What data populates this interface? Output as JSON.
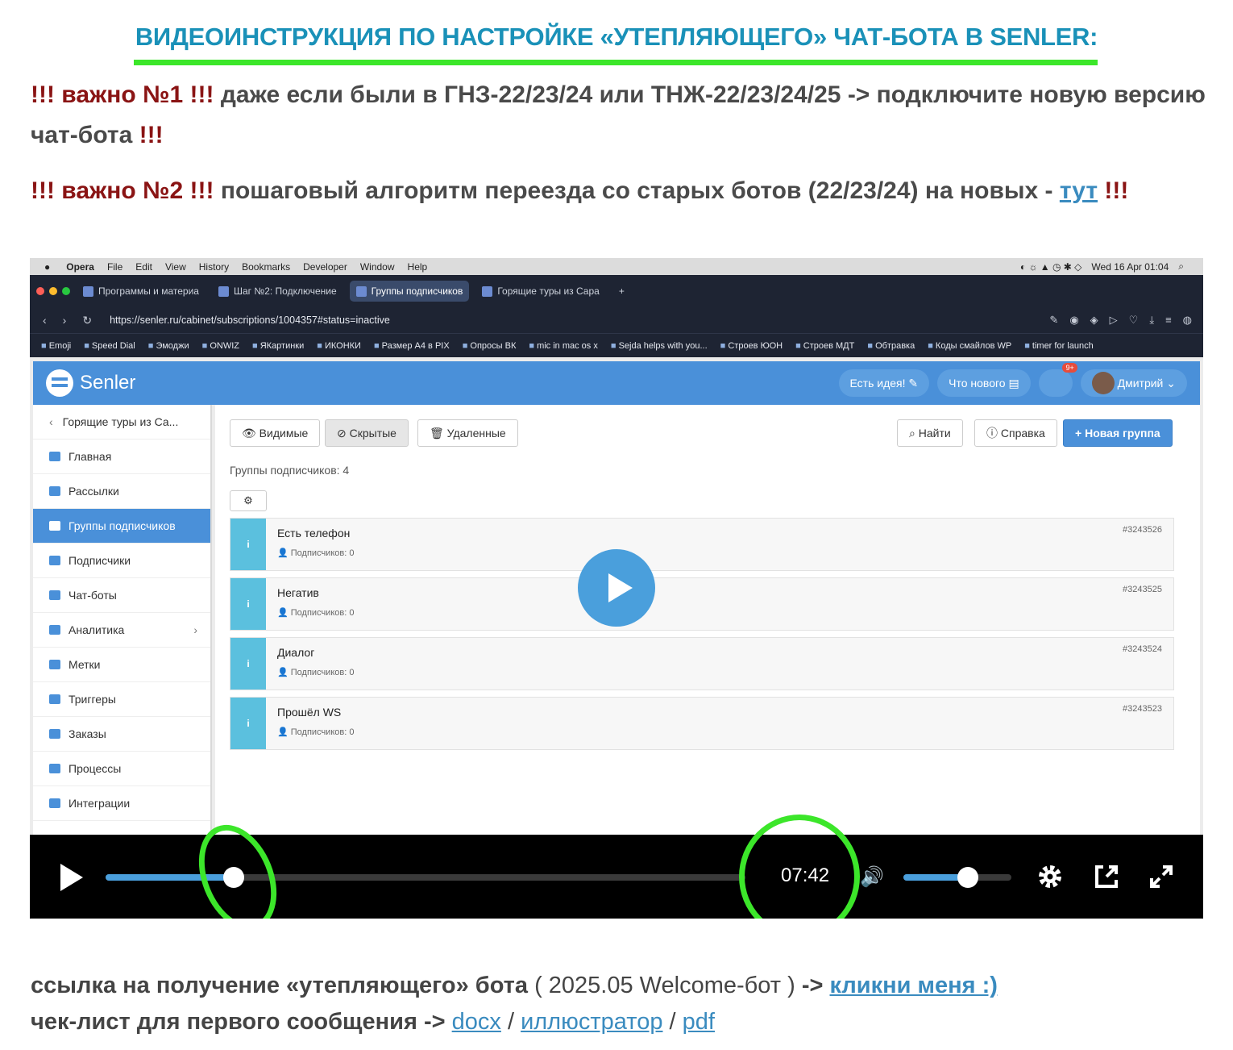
{
  "title": "ВИДЕОИНСТРУКЦИЯ ПО НАСТРОЙКЕ «УТЕПЛЯЮЩЕГО» ЧАТ-БОТА В SENLER:",
  "note1": {
    "prefix": "!!! важно №1 !!!",
    "text": " даже если были в ГНЗ-22/23/24 или ТНЖ-22/23/24/25 -> подключите новую версию чат-бота ",
    "suffix": "!!!"
  },
  "note2": {
    "prefix": "!!! важно №2 !!!",
    "text": " пошаговый алгоритм переезда со старых ботов (22/23/24) на новых - ",
    "link": "тут",
    "suffix": " !!!"
  },
  "video": {
    "mac_menu": [
      "Opera",
      "File",
      "Edit",
      "View",
      "History",
      "Bookmarks",
      "Developer",
      "Window",
      "Help"
    ],
    "mac_datetime": "Wed 16 Apr 01:04",
    "tabs": [
      {
        "label": "Программы и материа"
      },
      {
        "label": "Шаг №2: Подключение"
      },
      {
        "label": "Группы подписчиков"
      },
      {
        "label": "Горящие туры из Сара"
      }
    ],
    "url": "https://senler.ru/cabinet/subscriptions/1004357#status=inactive",
    "bookmarks": [
      "Emoji",
      "Speed Dial",
      "Эмоджи",
      "ONWIZ",
      "ЯКартинки",
      "ИКОНКИ",
      "Размер А4 в PIX",
      "Опросы ВК",
      "mic in mac os x",
      "Sejda helps with you...",
      "Строев ЮОН",
      "Строев МДТ",
      "Обтравка",
      "Коды смайлов WP",
      "timer for launch"
    ],
    "senler": {
      "logo": "Senler",
      "idea_btn": "Есть идея!",
      "news_btn": "Что нового",
      "badge": "9+",
      "user": "Дмитрий",
      "sidebar": [
        {
          "label": "Горящие туры из Са..."
        },
        {
          "label": "Главная"
        },
        {
          "label": "Рассылки"
        },
        {
          "label": "Группы подписчиков"
        },
        {
          "label": "Подписчики"
        },
        {
          "label": "Чат-боты"
        },
        {
          "label": "Аналитика"
        },
        {
          "label": "Метки"
        },
        {
          "label": "Триггеры"
        },
        {
          "label": "Заказы"
        },
        {
          "label": "Процессы"
        },
        {
          "label": "Интеграции"
        }
      ],
      "filter_visible": "Видимые",
      "filter_hidden": "Скрытые",
      "filter_deleted": "Удаленные",
      "find_btn": "Найти",
      "help_btn": "Справка",
      "new_group_btn": "Новая группа",
      "groups_count": "Группы подписчиков: 4",
      "groups": [
        {
          "name": "Есть телефон",
          "subs": "Подписчиков: 0",
          "id": "#3243526"
        },
        {
          "name": "Негатив",
          "subs": "Подписчиков: 0",
          "id": "#3243525"
        },
        {
          "name": "Диалог",
          "subs": "Подписчиков: 0",
          "id": "#3243524"
        },
        {
          "name": "Прошёл WS",
          "subs": "Подписчиков: 0",
          "id": "#3243523"
        }
      ]
    },
    "player": {
      "time": "07:42",
      "progress": 0.2,
      "volume": 0.6
    }
  },
  "footer": {
    "line1_text": "ссылка на получение «утепляющего» бота",
    "line1_meta": " ( 2025.05 Welcome-бот ) ",
    "line1_arrow": "->",
    "line1_link": "кликни меня :)",
    "line2_text": "чек-лист для первого сообщения ->",
    "link_docx": "docx",
    "link_illustrator": "иллюстратор",
    "link_pdf": "pdf"
  },
  "colors": {
    "title": "#1a91b8",
    "underline": "#3ce62a",
    "important": "#8a1414",
    "link": "#3a8bbf",
    "senler_blue": "#4a90d9"
  }
}
